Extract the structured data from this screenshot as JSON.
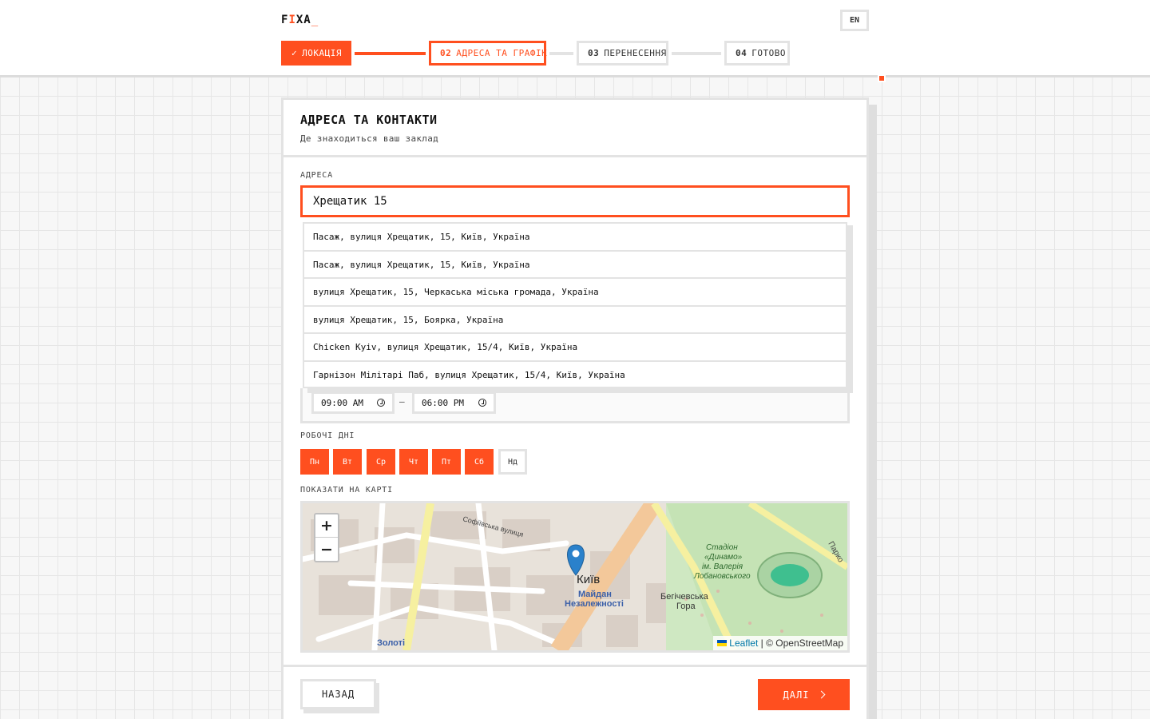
{
  "logo": {
    "prefix": "F",
    "highlight": "I",
    "suffix": "XA",
    "cursor": "_"
  },
  "lang": "EN",
  "steps": [
    {
      "num": "",
      "label": "ЛОКАЦІЯ",
      "state": "done"
    },
    {
      "num": "02",
      "label": "АДРЕСА ТА ГРАФІК",
      "state": "active"
    },
    {
      "num": "03",
      "label": "ПЕРЕНЕСЕННЯ",
      "state": "pending"
    },
    {
      "num": "04",
      "label": "ГОТОВО",
      "state": "pending"
    }
  ],
  "card": {
    "title": "АДРЕСА ТА КОНТАКТИ",
    "subtitle": "Де знаходиться ваш заклад"
  },
  "address": {
    "label": "АДРЕСА",
    "value": "Хрещатик 15",
    "suggestions": [
      "Пасаж, вулиця Хрещатик, 15, Київ, Україна",
      "Пасаж, вулиця Хрещатик, 15, Київ, Україна",
      "вулиця Хрещатик, 15, Черкаська міська громада, Україна",
      "вулиця Хрещатик, 15, Боярка, Україна",
      "Chicken Kyiv, вулиця Хрещатик, 15/4, Київ, Україна",
      "Гарнізон Мілітарі Паб, вулиця Хрещатик, 15/4, Київ, Україна"
    ]
  },
  "hours": {
    "open": "09:00 AM",
    "close": "06:00 PM",
    "separator": "—"
  },
  "days": {
    "label": "РОБОЧІ ДНІ",
    "items": [
      {
        "label": "Пн",
        "active": true
      },
      {
        "label": "Вт",
        "active": true
      },
      {
        "label": "Ср",
        "active": true
      },
      {
        "label": "Чт",
        "active": true
      },
      {
        "label": "Пт",
        "active": true
      },
      {
        "label": "Сб",
        "active": true
      },
      {
        "label": "Нд",
        "active": false
      }
    ]
  },
  "map": {
    "label": "ПОКАЗАТИ НА КАРТІ",
    "zoom_in": "+",
    "zoom_out": "−",
    "attribution_leaflet": "Leaflet",
    "attribution_sep": " | © ",
    "attribution_osm": "OpenStreetMap",
    "labels": {
      "city": "Київ",
      "square1": "Майдан",
      "square2": "Незалежності",
      "area1": "Бегічевська",
      "area2": "Гора",
      "stadium1": "Стадіон",
      "stadium2": "«Динамо»",
      "stadium3": "ім. Валерія",
      "stadium4": "Лобановського",
      "gate": "Золоті",
      "street1": "Софіївська вулиця",
      "street2": "Парко"
    }
  },
  "nav": {
    "back": "НАЗАД",
    "next": "ДАЛІ"
  },
  "colors": {
    "accent": "#ff4f1f",
    "border": "#e3e3e3"
  }
}
